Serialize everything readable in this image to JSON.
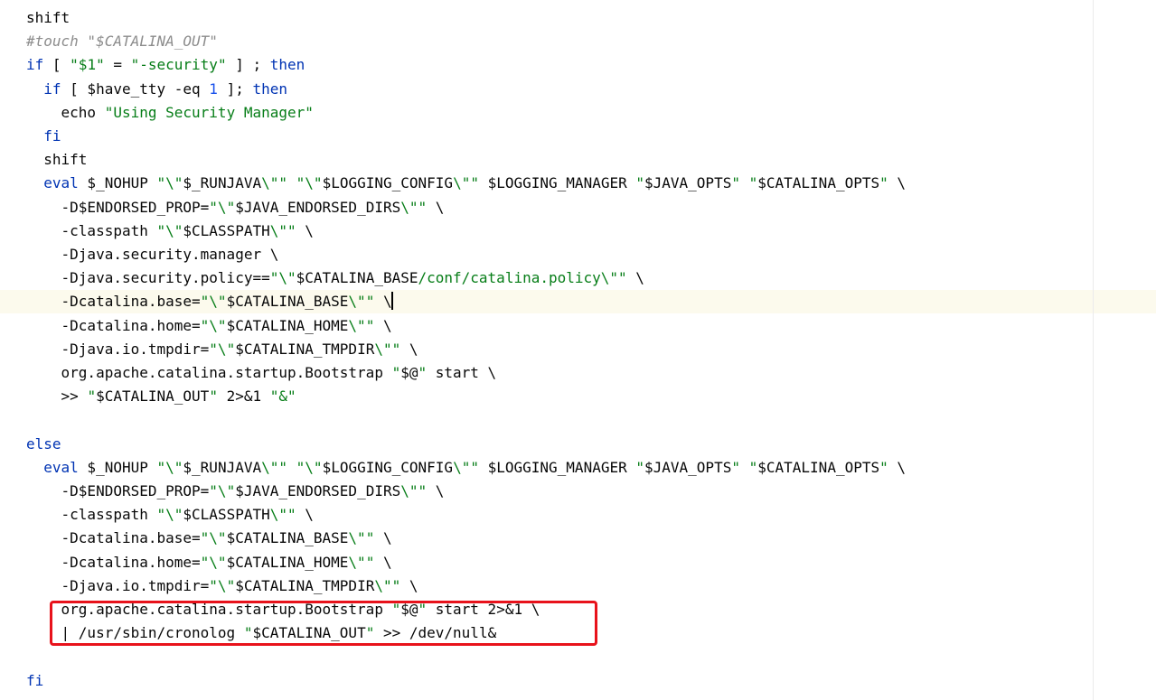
{
  "editor": {
    "language": "shell",
    "current_line_index": 12,
    "highlight_color": "#e8121b",
    "lines": [
      [
        [
          "shift",
          "plain"
        ]
      ],
      [
        [
          "#touch \"$CATALINA_OUT\"",
          "cmt"
        ]
      ],
      [
        [
          "if",
          "kw"
        ],
        [
          " [ ",
          "plain"
        ],
        [
          "\"$1\"",
          "str"
        ],
        [
          " = ",
          "plain"
        ],
        [
          "\"-security\"",
          "str"
        ],
        [
          " ] ; ",
          "plain"
        ],
        [
          "then",
          "kw"
        ]
      ],
      [
        [
          "  ",
          "plain"
        ],
        [
          "if",
          "kw"
        ],
        [
          " [ $have_tty -eq ",
          "plain"
        ],
        [
          "1",
          "num"
        ],
        [
          " ]; ",
          "plain"
        ],
        [
          "then",
          "kw"
        ]
      ],
      [
        [
          "    echo ",
          "plain"
        ],
        [
          "\"Using Security Manager\"",
          "str"
        ]
      ],
      [
        [
          "  ",
          "plain"
        ],
        [
          "fi",
          "kw"
        ]
      ],
      [
        [
          "  shift",
          "plain"
        ]
      ],
      [
        [
          "  ",
          "plain"
        ],
        [
          "eval",
          "kw"
        ],
        [
          " $_NOHUP ",
          "plain"
        ],
        [
          "\"\\\"",
          "str"
        ],
        [
          "$_RUNJAVA",
          "var"
        ],
        [
          "\\\"\"",
          "str"
        ],
        [
          " ",
          "plain"
        ],
        [
          "\"\\\"",
          "str"
        ],
        [
          "$LOGGING_CONFIG",
          "var"
        ],
        [
          "\\\"\"",
          "str"
        ],
        [
          " $LOGGING_MANAGER ",
          "plain"
        ],
        [
          "\"",
          "str"
        ],
        [
          "$JAVA_OPTS",
          "var"
        ],
        [
          "\"",
          "str"
        ],
        [
          " ",
          "plain"
        ],
        [
          "\"",
          "str"
        ],
        [
          "$CATALINA_OPTS",
          "var"
        ],
        [
          "\"",
          "str"
        ],
        [
          " \\",
          "plain"
        ]
      ],
      [
        [
          "    -D$ENDORSED_PROP=",
          "plain"
        ],
        [
          "\"\\\"",
          "str"
        ],
        [
          "$JAVA_ENDORSED_DIRS",
          "var"
        ],
        [
          "\\\"\"",
          "str"
        ],
        [
          " \\",
          "plain"
        ]
      ],
      [
        [
          "    -classpath ",
          "plain"
        ],
        [
          "\"\\\"",
          "str"
        ],
        [
          "$CLASSPATH",
          "var"
        ],
        [
          "\\\"\"",
          "str"
        ],
        [
          " \\",
          "plain"
        ]
      ],
      [
        [
          "    -Djava.security.manager \\",
          "plain"
        ]
      ],
      [
        [
          "    -Djava.security.policy==",
          "plain"
        ],
        [
          "\"\\\"",
          "str"
        ],
        [
          "$CATALINA_BASE",
          "var"
        ],
        [
          "/conf/catalina.policy\\\"\"",
          "str"
        ],
        [
          " \\",
          "plain"
        ]
      ],
      [
        [
          "    -Dcatalina.base=",
          "plain"
        ],
        [
          "\"\\\"",
          "str"
        ],
        [
          "$CATALINA_BASE",
          "var"
        ],
        [
          "\\\"\"",
          "str"
        ],
        [
          " \\",
          "plain"
        ]
      ],
      [
        [
          "    -Dcatalina.home=",
          "plain"
        ],
        [
          "\"\\\"",
          "str"
        ],
        [
          "$CATALINA_HOME",
          "var"
        ],
        [
          "\\\"\"",
          "str"
        ],
        [
          " \\",
          "plain"
        ]
      ],
      [
        [
          "    -Djava.io.tmpdir=",
          "plain"
        ],
        [
          "\"\\\"",
          "str"
        ],
        [
          "$CATALINA_TMPDIR",
          "var"
        ],
        [
          "\\\"\"",
          "str"
        ],
        [
          " \\",
          "plain"
        ]
      ],
      [
        [
          "    org.apache.catalina.startup.Bootstrap ",
          "plain"
        ],
        [
          "\"",
          "str"
        ],
        [
          "$@",
          "var"
        ],
        [
          "\"",
          "str"
        ],
        [
          " start \\",
          "plain"
        ]
      ],
      [
        [
          "    >> ",
          "plain"
        ],
        [
          "\"",
          "str"
        ],
        [
          "$CATALINA_OUT",
          "var"
        ],
        [
          "\"",
          "str"
        ],
        [
          " 2>&1 ",
          "plain"
        ],
        [
          "\"&\"",
          "str"
        ]
      ],
      [],
      [
        [
          "else",
          "kw"
        ]
      ],
      [
        [
          "  ",
          "plain"
        ],
        [
          "eval",
          "kw"
        ],
        [
          " $_NOHUP ",
          "plain"
        ],
        [
          "\"\\\"",
          "str"
        ],
        [
          "$_RUNJAVA",
          "var"
        ],
        [
          "\\\"\"",
          "str"
        ],
        [
          " ",
          "plain"
        ],
        [
          "\"\\\"",
          "str"
        ],
        [
          "$LOGGING_CONFIG",
          "var"
        ],
        [
          "\\\"\"",
          "str"
        ],
        [
          " $LOGGING_MANAGER ",
          "plain"
        ],
        [
          "\"",
          "str"
        ],
        [
          "$JAVA_OPTS",
          "var"
        ],
        [
          "\"",
          "str"
        ],
        [
          " ",
          "plain"
        ],
        [
          "\"",
          "str"
        ],
        [
          "$CATALINA_OPTS",
          "var"
        ],
        [
          "\"",
          "str"
        ],
        [
          " \\",
          "plain"
        ]
      ],
      [
        [
          "    -D$ENDORSED_PROP=",
          "plain"
        ],
        [
          "\"\\\"",
          "str"
        ],
        [
          "$JAVA_ENDORSED_DIRS",
          "var"
        ],
        [
          "\\\"\"",
          "str"
        ],
        [
          " \\",
          "plain"
        ]
      ],
      [
        [
          "    -classpath ",
          "plain"
        ],
        [
          "\"\\\"",
          "str"
        ],
        [
          "$CLASSPATH",
          "var"
        ],
        [
          "\\\"\"",
          "str"
        ],
        [
          " \\",
          "plain"
        ]
      ],
      [
        [
          "    -Dcatalina.base=",
          "plain"
        ],
        [
          "\"\\\"",
          "str"
        ],
        [
          "$CATALINA_BASE",
          "var"
        ],
        [
          "\\\"\"",
          "str"
        ],
        [
          " \\",
          "plain"
        ]
      ],
      [
        [
          "    -Dcatalina.home=",
          "plain"
        ],
        [
          "\"\\\"",
          "str"
        ],
        [
          "$CATALINA_HOME",
          "var"
        ],
        [
          "\\\"\"",
          "str"
        ],
        [
          " \\",
          "plain"
        ]
      ],
      [
        [
          "    -Djava.io.tmpdir=",
          "plain"
        ],
        [
          "\"\\\"",
          "str"
        ],
        [
          "$CATALINA_TMPDIR",
          "var"
        ],
        [
          "\\\"\"",
          "str"
        ],
        [
          " \\",
          "plain"
        ]
      ],
      [
        [
          "    org.apache.catalina.startup.Bootstrap ",
          "plain"
        ],
        [
          "\"",
          "str"
        ],
        [
          "$@",
          "var"
        ],
        [
          "\"",
          "str"
        ],
        [
          " start 2>&1 \\",
          "plain"
        ]
      ],
      [
        [
          "    | /usr/sbin/cronolog ",
          "plain"
        ],
        [
          "\"",
          "str"
        ],
        [
          "$CATALINA_OUT",
          "var"
        ],
        [
          "\"",
          "str"
        ],
        [
          " >> /dev/null&",
          "plain"
        ]
      ],
      [],
      [
        [
          "fi",
          "kw"
        ]
      ]
    ]
  }
}
